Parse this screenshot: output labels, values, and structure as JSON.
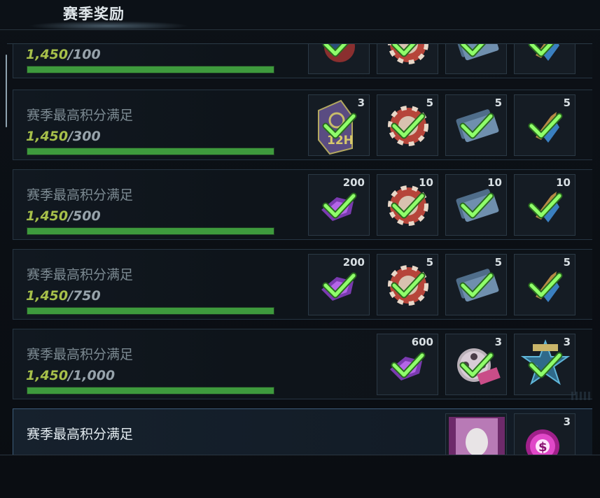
{
  "header": {
    "title": "赛季奖励"
  },
  "rows": [
    {
      "label": "",
      "current": "1,450",
      "target": "/100",
      "progress": 1.0,
      "highlight": false,
      "rewards": [
        {
          "icon": "bomb-icon",
          "count": "",
          "claimed": true
        },
        {
          "icon": "poker-chip-icon",
          "count": "",
          "claimed": true
        },
        {
          "icon": "ticket-icon",
          "count": "",
          "claimed": true
        },
        {
          "icon": "bullet-icon",
          "count": "",
          "claimed": true
        }
      ]
    },
    {
      "label": "赛季最高积分满足",
      "current": "1,450",
      "target": "/300",
      "progress": 1.0,
      "highlight": false,
      "rewards": [
        {
          "icon": "12h-card-icon",
          "count": "3",
          "claimed": true,
          "card_text": "12H"
        },
        {
          "icon": "poker-chip-icon",
          "count": "5",
          "claimed": true
        },
        {
          "icon": "ticket-icon",
          "count": "5",
          "claimed": true
        },
        {
          "icon": "bullet-icon",
          "count": "5",
          "claimed": true
        }
      ]
    },
    {
      "label": "赛季最高积分满足",
      "current": "1,450",
      "target": "/500",
      "progress": 1.0,
      "highlight": false,
      "rewards": [
        {
          "icon": "purple-gem-icon",
          "count": "200",
          "claimed": true
        },
        {
          "icon": "poker-chip-icon",
          "count": "10",
          "claimed": true
        },
        {
          "icon": "ticket-icon",
          "count": "10",
          "claimed": true
        },
        {
          "icon": "bullet-icon",
          "count": "10",
          "claimed": true
        }
      ]
    },
    {
      "label": "赛季最高积分满足",
      "current": "1,450",
      "target": "/750",
      "progress": 1.0,
      "highlight": false,
      "rewards": [
        {
          "icon": "purple-gem-icon",
          "count": "200",
          "claimed": true
        },
        {
          "icon": "poker-chip-icon",
          "count": "5",
          "claimed": true
        },
        {
          "icon": "ticket-icon",
          "count": "5",
          "claimed": true
        },
        {
          "icon": "bullet-icon",
          "count": "5",
          "claimed": true
        }
      ]
    },
    {
      "label": "赛季最高积分满足",
      "current": "1,450",
      "target": "/1,000",
      "progress": 1.0,
      "highlight": false,
      "rewards": [
        {
          "icon": "purple-gem-icon",
          "count": "600",
          "claimed": true
        },
        {
          "icon": "film-reel-icon",
          "count": "3",
          "claimed": true
        },
        {
          "icon": "star-badge-icon",
          "count": "3",
          "claimed": true
        }
      ]
    },
    {
      "label": "赛季最高积分满足",
      "current": "",
      "target": "",
      "progress": 0,
      "highlight": true,
      "rewards": [
        {
          "icon": "poster-frame-icon",
          "count": "",
          "claimed": false
        },
        {
          "icon": "pink-orb-icon",
          "count": "3",
          "claimed": false
        }
      ]
    }
  ],
  "colors": {
    "check": "#8fff6a",
    "bar": "#3e9a3d",
    "current": "#a7c04a",
    "accent_border": "#3e5d7a"
  }
}
